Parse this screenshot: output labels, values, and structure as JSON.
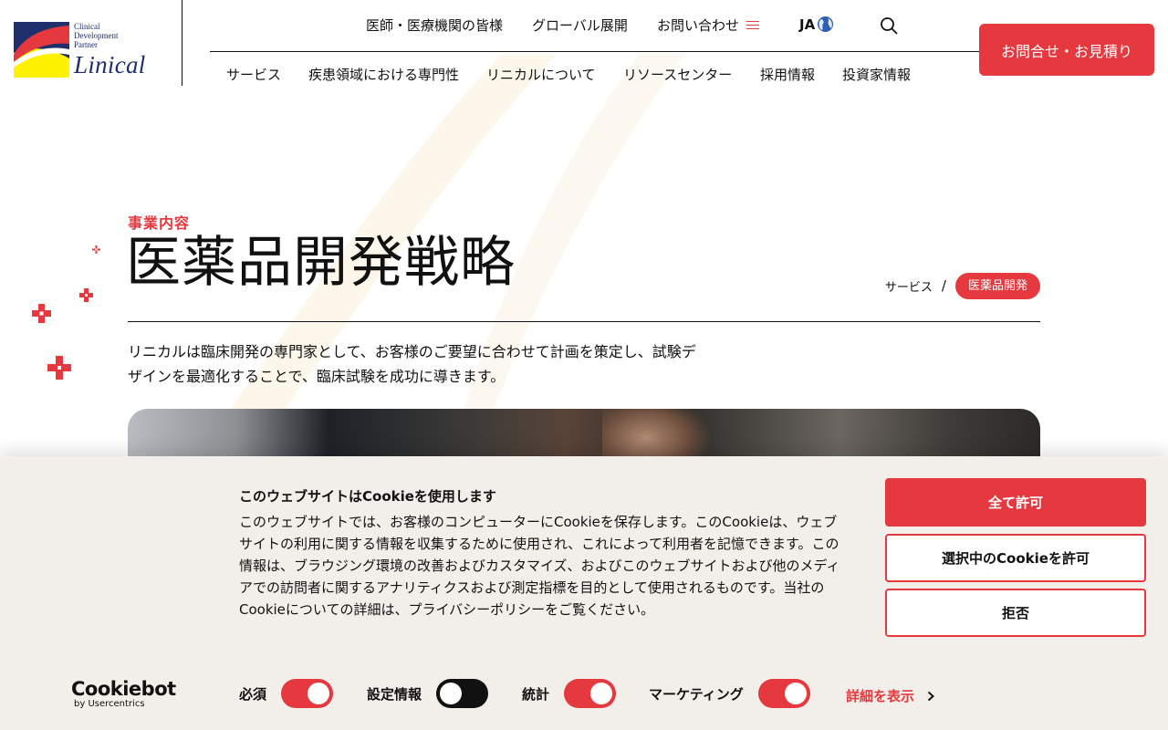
{
  "logo": {
    "tagline": [
      "Clinical",
      "Development",
      "Partner"
    ],
    "wordmark": "Linical",
    "colors": {
      "navy": "#1e2f6b",
      "red": "#e6383f",
      "yellow": "#fff200"
    }
  },
  "utility_nav": {
    "items": [
      {
        "label": "医師・医療機関の皆様"
      },
      {
        "label": "グローバル展開"
      },
      {
        "label": "お問い合わせ"
      }
    ],
    "language": "JA",
    "search_icon": "search-icon"
  },
  "main_nav": {
    "items": [
      {
        "label": "サービス"
      },
      {
        "label": "疾患領域における専門性"
      },
      {
        "label": "リニカルについて"
      },
      {
        "label": "リソースセンター"
      },
      {
        "label": "採用情報"
      },
      {
        "label": "投資家情報"
      }
    ]
  },
  "cta": {
    "label": "お問合せ・お見積り"
  },
  "hero": {
    "eyebrow": "事業内容",
    "title": "医薬品開発戦略",
    "breadcrumb": {
      "parent": "サービス",
      "separator": "/",
      "current": "医薬品開発"
    },
    "intro_lines": [
      "リニカルは臨床開発の専門家として、お客様のご要望に合わせて計画を策定し、試験デ",
      "ザインを最適化することで、臨床試験を成功に導きます。"
    ]
  },
  "cookie_banner": {
    "title": "このウェブサイトはCookieを使用します",
    "body": "このウェブサイトでは、お客様のコンピューターにCookieを保存します。このCookieは、ウェブサイトの利用に関する情報を収集するために使用され、これによって利用者を記憶できます。この情報は、ブラウジング環境の改善およびカスタマイズ、およびこのウェブサイトおよび他のメディアでの訪問者に関するアナリティクスおよび測定指標を目的として使用されるものです。当社のCookieについての詳細は、プライバシーポリシーをご覧ください。",
    "buttons": {
      "allow_all": "全て許可",
      "allow_selected": "選択中のCookieを許可",
      "deny": "拒否"
    },
    "brand": {
      "name": "Cookiebot",
      "by": "by Usercentrics"
    },
    "toggles": [
      {
        "label": "必須",
        "enabled": true
      },
      {
        "label": "設定情報",
        "enabled": false
      },
      {
        "label": "統計",
        "enabled": true
      },
      {
        "label": "マーケティング",
        "enabled": true
      }
    ],
    "details_link": "詳細を表示"
  },
  "colors": {
    "accent": "#e6383f",
    "text": "#111111",
    "banner_bg": "#f2eee9"
  }
}
